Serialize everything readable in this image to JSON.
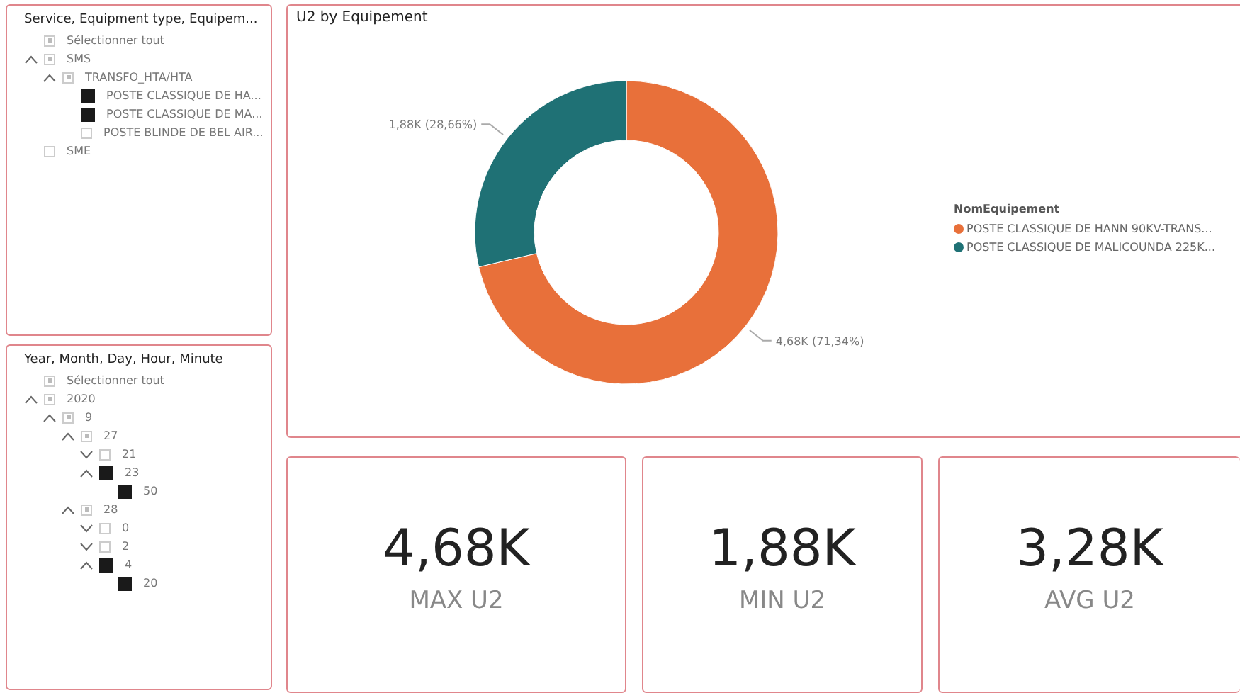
{
  "slicers": [
    {
      "title": "Service, Equipment type, Equipem...",
      "items": [
        {
          "label": "Sélectionner tout",
          "checked": false,
          "partial": true
        },
        {
          "label": "SMS",
          "checked": false,
          "partial": true,
          "expanded": true,
          "children": [
            {
              "label": "TRANSFO_HTA/HTA",
              "checked": false,
              "partial": true,
              "expanded": true,
              "children": [
                {
                  "label": "POSTE CLASSIQUE DE HA...",
                  "checked": true,
                  "partial": false
                },
                {
                  "label": "POSTE CLASSIQUE DE MA...",
                  "checked": true,
                  "partial": false
                },
                {
                  "label": "POSTE BLINDE DE BEL AIR...",
                  "checked": false,
                  "partial": false
                }
              ]
            }
          ]
        },
        {
          "label": "SME",
          "checked": false,
          "partial": false
        }
      ]
    },
    {
      "title": "Year, Month, Day, Hour, Minute",
      "items": [
        {
          "label": "Sélectionner tout",
          "checked": false,
          "partial": true
        },
        {
          "label": "2020",
          "checked": false,
          "partial": true,
          "expanded": true,
          "children": [
            {
              "label": "9",
              "checked": false,
              "partial": true,
              "expanded": true,
              "children": [
                {
                  "label": "27",
                  "checked": false,
                  "partial": true,
                  "expanded": true,
                  "children": [
                    {
                      "label": "21",
                      "checked": false,
                      "partial": false,
                      "expanded": false
                    },
                    {
                      "label": "23",
                      "checked": true,
                      "partial": false,
                      "expanded": true,
                      "children": [
                        {
                          "label": "50",
                          "checked": true,
                          "partial": false
                        }
                      ]
                    }
                  ]
                },
                {
                  "label": "28",
                  "checked": false,
                  "partial": true,
                  "expanded": true,
                  "children": [
                    {
                      "label": "0",
                      "checked": false,
                      "partial": false,
                      "expanded": false
                    },
                    {
                      "label": "2",
                      "checked": false,
                      "partial": false,
                      "expanded": false
                    },
                    {
                      "label": "4",
                      "checked": true,
                      "partial": false,
                      "expanded": true,
                      "children": [
                        {
                          "label": "20",
                          "checked": true,
                          "partial": false
                        }
                      ]
                    }
                  ]
                }
              ]
            }
          ]
        }
      ]
    }
  ],
  "donut": {
    "title": "U2 by Equipement",
    "legend_title": "NomEquipement",
    "chart_data": {
      "type": "donut",
      "categories": [
        "POSTE  CLASSIQUE DE HANN 90KV-TRANS...",
        "POSTE CLASSIQUE DE MALICOUNDA 225K..."
      ],
      "values": [
        4680,
        1880
      ],
      "colors": [
        "#e8703a",
        "#1f7175"
      ],
      "value_labels": [
        "4,68K (71,34%)",
        "1,88K (28,66%)"
      ]
    }
  },
  "cards": [
    {
      "value": "4,68K",
      "label": "MAX U2"
    },
    {
      "value": "1,88K",
      "label": "MIN U2"
    },
    {
      "value": "3,28K",
      "label": "AVG U2"
    }
  ]
}
